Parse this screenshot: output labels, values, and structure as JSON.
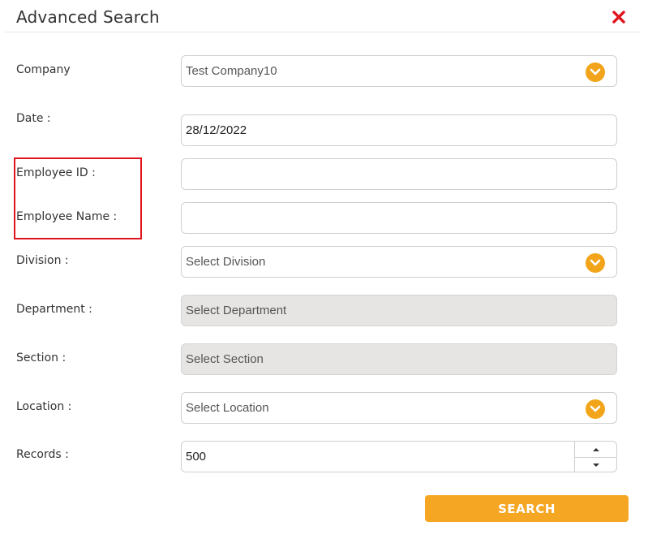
{
  "dialog": {
    "title": "Advanced Search",
    "close_icon": "close-x-icon",
    "accent_color": "#f2a51a",
    "close_color": "#e0141e"
  },
  "form": {
    "company": {
      "label": "Company",
      "value": "Test Company10"
    },
    "date": {
      "label": "Date :",
      "value": "28/12/2022"
    },
    "employee_id": {
      "label": "Employee ID :",
      "value": ""
    },
    "employee_name": {
      "label": "Employee Name :",
      "value": ""
    },
    "division": {
      "label": "Division :",
      "placeholder": "Select Division"
    },
    "department": {
      "label": "Department :",
      "placeholder": "Select Department",
      "disabled": true
    },
    "section": {
      "label": "Section :",
      "placeholder": "Select Section",
      "disabled": true
    },
    "location": {
      "label": "Location :",
      "placeholder": "Select Location"
    },
    "records": {
      "label": "Records :",
      "value": "500"
    }
  },
  "search_button": {
    "label": "SEARCH"
  }
}
